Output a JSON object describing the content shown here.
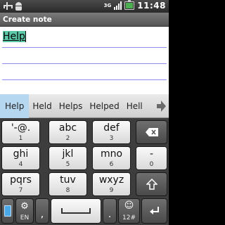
{
  "status_bar": {
    "network": "3G",
    "time": "11:48"
  },
  "title_bar": {
    "title": "Create note"
  },
  "note": {
    "text": "Help"
  },
  "suggestions": [
    "Help",
    "Held",
    "Helps",
    "Helped",
    "Hell"
  ],
  "keyboard": {
    "row1": [
      {
        "main": "'-@.",
        "sub": "1"
      },
      {
        "main": "abc",
        "sub": "2"
      },
      {
        "main": "def",
        "sub": "3"
      }
    ],
    "row2": [
      {
        "main": "ghi",
        "sub": "4"
      },
      {
        "main": "jkl",
        "sub": "5"
      },
      {
        "main": "mno",
        "sub": "6"
      }
    ],
    "row3": [
      {
        "main": "pqrs",
        "sub": "7"
      },
      {
        "main": "tuv",
        "sub": "8"
      },
      {
        "main": "wxyz",
        "sub": "9"
      }
    ],
    "minus_key": {
      "main": "-",
      "sub": "0"
    },
    "settings_key": {
      "sub": "EN"
    },
    "comma_key": ",",
    "period_key": ".",
    "symbols_key": {
      "sub": "12#"
    }
  },
  "colors": {
    "selection": "#5cc8a8",
    "note_lines": "#8d8df0",
    "suggestion_highlight": "#b6d7f0"
  }
}
